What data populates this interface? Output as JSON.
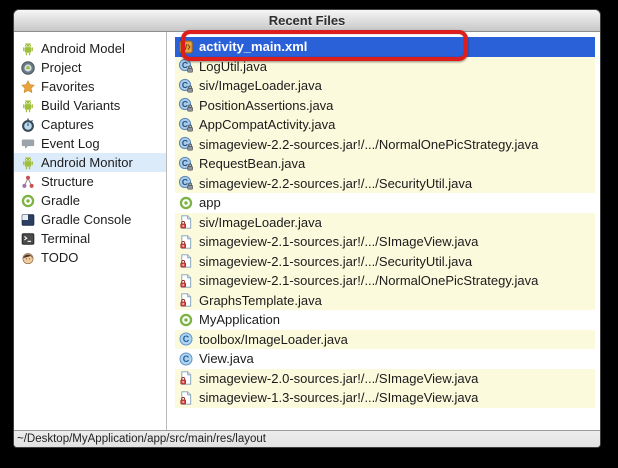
{
  "window": {
    "title": "Recent Files"
  },
  "sidebar": {
    "items": [
      {
        "label": "Android Model",
        "icon": "android",
        "highlighted": false
      },
      {
        "label": "Project",
        "icon": "project",
        "highlighted": false
      },
      {
        "label": "Favorites",
        "icon": "star",
        "highlighted": false
      },
      {
        "label": "Build Variants",
        "icon": "android",
        "highlighted": false
      },
      {
        "label": "Captures",
        "icon": "stopwatch",
        "highlighted": false
      },
      {
        "label": "Event Log",
        "icon": "speech-bubble",
        "highlighted": false
      },
      {
        "label": "Android Monitor",
        "icon": "android",
        "highlighted": true
      },
      {
        "label": "Structure",
        "icon": "structure",
        "highlighted": false
      },
      {
        "label": "Gradle",
        "icon": "gradle",
        "highlighted": false
      },
      {
        "label": "Gradle Console",
        "icon": "console",
        "highlighted": false
      },
      {
        "label": "Terminal",
        "icon": "terminal",
        "highlighted": false
      },
      {
        "label": "TODO",
        "icon": "todo",
        "highlighted": false
      }
    ]
  },
  "files": {
    "rows": [
      {
        "label": "activity_main.xml",
        "icon": "xml-layout",
        "state": "selected",
        "annotated": true
      },
      {
        "label": "LogUtil.java",
        "icon": "class-lock",
        "state": "yellow"
      },
      {
        "label": "siv/ImageLoader.java",
        "icon": "class-lock",
        "state": "yellow"
      },
      {
        "label": "PositionAssertions.java",
        "icon": "class-lock",
        "state": "yellow"
      },
      {
        "label": "AppCompatActivity.java",
        "icon": "class-lock",
        "state": "yellow"
      },
      {
        "label": "simageview-2.2-sources.jar!/.../NormalOnePicStrategy.java",
        "icon": "class-lock",
        "state": "yellow"
      },
      {
        "label": "RequestBean.java",
        "icon": "class-lock",
        "state": "yellow"
      },
      {
        "label": "simageview-2.2-sources.jar!/.../SecurityUtil.java",
        "icon": "class-lock",
        "state": "yellow"
      },
      {
        "label": "app",
        "icon": "gradle",
        "state": "white"
      },
      {
        "label": "siv/ImageLoader.java",
        "icon": "file-lock",
        "state": "yellow"
      },
      {
        "label": "simageview-2.1-sources.jar!/.../SImageView.java",
        "icon": "file-lock",
        "state": "yellow"
      },
      {
        "label": "simageview-2.1-sources.jar!/.../SecurityUtil.java",
        "icon": "file-lock",
        "state": "yellow"
      },
      {
        "label": "simageview-2.1-sources.jar!/.../NormalOnePicStrategy.java",
        "icon": "file-lock",
        "state": "yellow"
      },
      {
        "label": "GraphsTemplate.java",
        "icon": "file-lock",
        "state": "yellow"
      },
      {
        "label": "MyApplication",
        "icon": "gradle",
        "state": "white"
      },
      {
        "label": "toolbox/ImageLoader.java",
        "icon": "class-plain",
        "state": "yellow"
      },
      {
        "label": "View.java",
        "icon": "class-plain",
        "state": "white"
      },
      {
        "label": "simageview-2.0-sources.jar!/.../SImageView.java",
        "icon": "file-lock",
        "state": "yellow"
      },
      {
        "label": "simageview-1.3-sources.jar!/.../SImageView.java",
        "icon": "file-lock",
        "state": "yellow"
      }
    ]
  },
  "statusbar": {
    "path": "~/Desktop/MyApplication/app/src/main/res/layout"
  },
  "colors": {
    "selection": "#2a60d8",
    "non_project_row": "#fcfadc",
    "sidebar_highlight": "#dcebfa",
    "annotation": "#de1e1c",
    "android_green": "#9fbf3b",
    "favorites_star": "#e9a33c"
  }
}
